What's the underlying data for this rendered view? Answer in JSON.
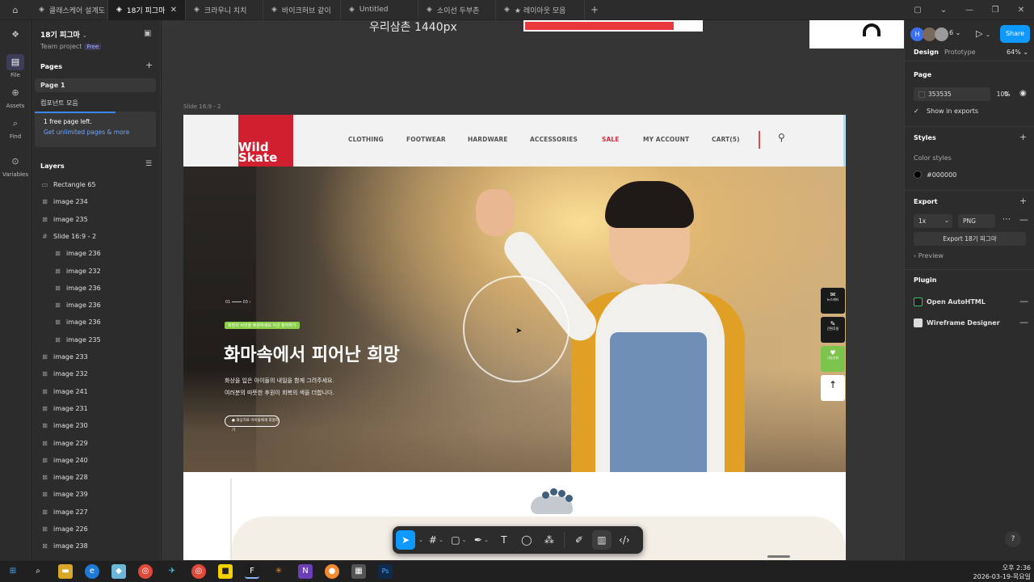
{
  "tabs": [
    {
      "label": "클래스케어 설계도",
      "active": false
    },
    {
      "label": "18기 피그마",
      "active": true
    },
    {
      "label": "크라우니 치치",
      "active": false
    },
    {
      "label": "바이크허브 같이",
      "active": false
    },
    {
      "label": "Untitled",
      "active": false
    },
    {
      "label": "소이선 두부촌",
      "active": false
    },
    {
      "label": "★ 레이아웃 모음",
      "active": false
    }
  ],
  "rail": [
    {
      "icon": "figma-icon",
      "label": ""
    },
    {
      "icon": "file-icon",
      "label": "File"
    },
    {
      "icon": "assets-icon",
      "label": "Assets"
    },
    {
      "icon": "find-icon",
      "label": "Find"
    },
    {
      "icon": "variables-icon",
      "label": "Variables"
    }
  ],
  "project": {
    "title": "18기 피그마",
    "team": "Team project",
    "plan": "Free"
  },
  "pages": {
    "title": "Pages",
    "items": [
      "Page 1",
      "컴포넌트 모음"
    ]
  },
  "upsell": {
    "text": "1 free page left.",
    "link": "Get unlimited pages & more"
  },
  "layers": {
    "title": "Layers",
    "items": [
      {
        "name": "Rectangle 65",
        "indent": 0,
        "icon": "▭"
      },
      {
        "name": "image 234",
        "indent": 0,
        "icon": "⊠"
      },
      {
        "name": "image 235",
        "indent": 0,
        "icon": "⊠"
      },
      {
        "name": "Slide 16:9 - 2",
        "indent": 0,
        "icon": "#"
      },
      {
        "name": "image 236",
        "indent": 1,
        "icon": "⊠"
      },
      {
        "name": "image 232",
        "indent": 1,
        "icon": "⊠"
      },
      {
        "name": "image 236",
        "indent": 1,
        "icon": "⊠"
      },
      {
        "name": "image 236",
        "indent": 1,
        "icon": "⊠"
      },
      {
        "name": "image 236",
        "indent": 1,
        "icon": "⊠"
      },
      {
        "name": "image 235",
        "indent": 1,
        "icon": "⊠"
      },
      {
        "name": "image 233",
        "indent": 0,
        "icon": "⊠"
      },
      {
        "name": "image 232",
        "indent": 0,
        "icon": "⊠"
      },
      {
        "name": "image 241",
        "indent": 0,
        "icon": "⊠"
      },
      {
        "name": "image 231",
        "indent": 0,
        "icon": "⊠"
      },
      {
        "name": "image 230",
        "indent": 0,
        "icon": "⊠"
      },
      {
        "name": "image 229",
        "indent": 0,
        "icon": "⊠"
      },
      {
        "name": "image 240",
        "indent": 0,
        "icon": "⊠"
      },
      {
        "name": "image 228",
        "indent": 0,
        "icon": "⊠"
      },
      {
        "name": "image 239",
        "indent": 0,
        "icon": "⊠"
      },
      {
        "name": "image 227",
        "indent": 0,
        "icon": "⊠"
      },
      {
        "name": "image 226",
        "indent": 0,
        "icon": "⊠"
      },
      {
        "name": "image 238",
        "indent": 0,
        "icon": "⊠"
      }
    ]
  },
  "canvas": {
    "top_text": "우리삼촌 1440px",
    "frame_label": "Slide 16:9 - 2",
    "site": {
      "logo_line1": "Wild",
      "logo_line2": "Skate",
      "nav": [
        "CLOTHING",
        "FOOTWEAR",
        "HARDWARE",
        "ACCESSORIES",
        "SALE",
        "MY ACCOUNT",
        "CART(5)"
      ],
      "hero_mini": "01 ━━━━ 03 ›",
      "hero_tag": "희망의 씨앗을 후원하세요 지금 참여하기",
      "hero_title": "화마속에서 피어난 희망",
      "hero_desc1": "화상을 입은 아이들의 내일을 함께 그려주세요.",
      "hero_desc2": "여러분의 따뜻한 후원이 회복의 색을 더합니다.",
      "hero_btn": "● 화상치료 아이들에게 후원하기",
      "float": [
        "뉴스레터",
        "간편후원",
        "나눔신청"
      ]
    }
  },
  "toolbar": {
    "tools": [
      "move",
      "frame",
      "shape",
      "pen",
      "text",
      "comment",
      "actions",
      "draw",
      "dev-mode",
      "code"
    ]
  },
  "right": {
    "avatar_letter": "H",
    "collab_count": "6",
    "share": "Share",
    "tabs": [
      "Design",
      "Prototype"
    ],
    "zoom": "64%",
    "page_title": "Page",
    "bg_color": "353535",
    "bg_opacity": "100",
    "bg_unit": "%",
    "show_exports": "Show in exports",
    "styles_title": "Styles",
    "color_styles": "Color styles",
    "color_value": "#000000",
    "export_title": "Export",
    "export_scale": "1x",
    "export_format": "PNG",
    "export_button": "Export 18기 피그마",
    "preview": "Preview",
    "plugin_title": "Plugin",
    "plugins": [
      "Open AutoHTML",
      "Wireframe Designer"
    ],
    "help": "?"
  },
  "taskbar": {
    "time": "오후 2:36",
    "date": "2026-03-19-목요일"
  },
  "colors": {
    "accent": "#0d99ff",
    "brand_red": "#d02030",
    "canvas": "#353535"
  }
}
